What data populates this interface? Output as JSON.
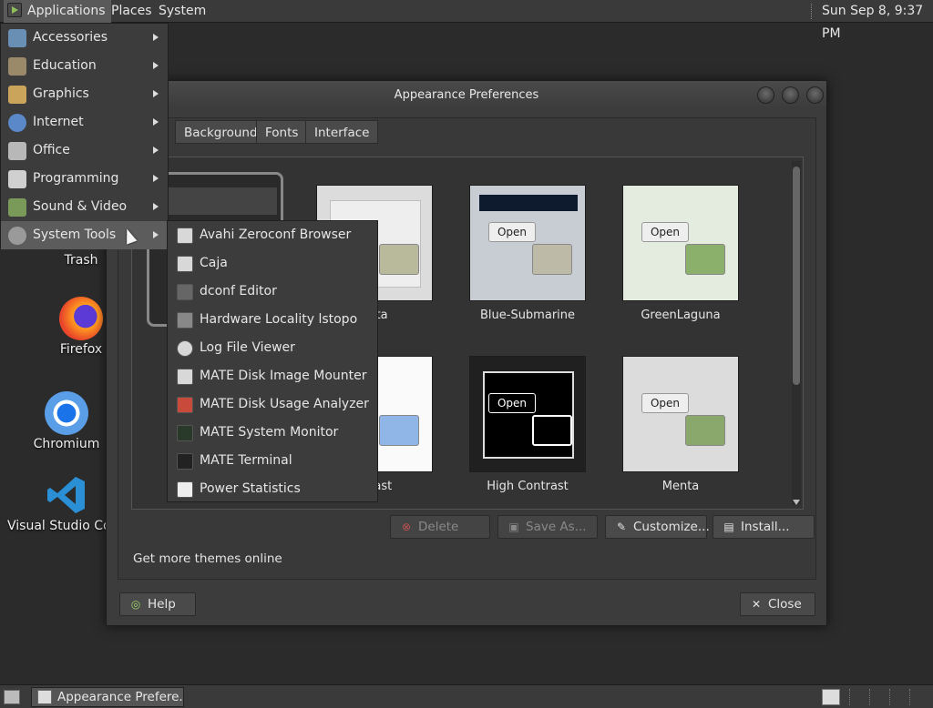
{
  "top_panel": {
    "applications": "Applications",
    "places": "Places",
    "system": "System",
    "clock": "Sun Sep  8,  9:37 PM"
  },
  "desktop_icons": {
    "trash": "Trash",
    "firefox": "Firefox",
    "chromium": "Chromium",
    "vscode": "Visual Studio Co"
  },
  "dialog": {
    "title": "Appearance Preferences",
    "tabs": {
      "background": "Background",
      "fonts": "Fonts",
      "interface": "Interface"
    },
    "themes": [
      {
        "name": "enta"
      },
      {
        "name": "Blue-Submarine"
      },
      {
        "name": "GreenLaguna"
      },
      {
        "name": "ntrast"
      },
      {
        "name": "High Contrast"
      },
      {
        "name": "Menta"
      }
    ],
    "thumb_open_label": "Open",
    "buttons": {
      "delete": "Delete",
      "save_as": "Save As...",
      "customize": "Customize...",
      "install": "Install...",
      "help": "Help",
      "close": "Close"
    },
    "get_more": "Get more themes online"
  },
  "apps_menu": {
    "items": [
      {
        "label": "Accessories",
        "icon": "accessories-icon"
      },
      {
        "label": "Education",
        "icon": "education-icon"
      },
      {
        "label": "Graphics",
        "icon": "graphics-icon"
      },
      {
        "label": "Internet",
        "icon": "internet-icon"
      },
      {
        "label": "Office",
        "icon": "office-icon"
      },
      {
        "label": "Programming",
        "icon": "programming-icon"
      },
      {
        "label": "Sound & Video",
        "icon": "sound-video-icon"
      },
      {
        "label": "System Tools",
        "icon": "system-tools-icon"
      }
    ]
  },
  "system_tools_menu": {
    "items": [
      "Avahi Zeroconf Browser",
      "Caja",
      "dconf Editor",
      "Hardware Locality lstopo",
      "Log File Viewer",
      "MATE Disk Image Mounter",
      "MATE Disk Usage Analyzer",
      "MATE System Monitor",
      "MATE Terminal",
      "Power Statistics"
    ]
  },
  "taskbar": {
    "appearance": "Appearance Prefere..."
  }
}
